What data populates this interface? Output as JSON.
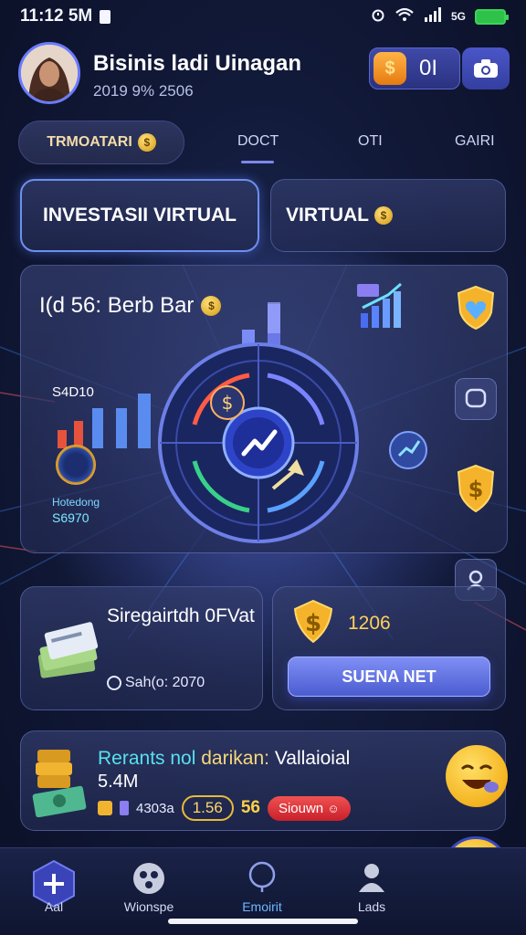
{
  "status_bar": {
    "time": "11:12 5M"
  },
  "header": {
    "user_name": "Bisinis ladi Uinagan",
    "user_sub": "2019 9% 2506",
    "coin_symbol": "$",
    "coin_value": "0I"
  },
  "tabs": {
    "active": "TRMOATARI",
    "items": [
      "DOCT",
      "OTI",
      "GAIRI"
    ]
  },
  "cards": {
    "invest_label": "INVESTASII VIRTUAL",
    "virtual_label": "VIRTUAL"
  },
  "main_panel": {
    "title": "I(d 56: Berb Bar",
    "value_label": "S4D10",
    "balance_label": "Hotedong",
    "balance_value": "S6970"
  },
  "savings": {
    "title": "Siregairtdh 0FVat",
    "subtitle": "Sah(o: 2070"
  },
  "coins": {
    "value": "1206",
    "button_label": "SUENA NET"
  },
  "rewards": {
    "title_a": "Rerants",
    "title_b": "nol",
    "title_c": "darikan:",
    "title_d": "Vallaioial",
    "amount": "5.4M",
    "stat": "4303a",
    "pill": "1.56",
    "count": "56",
    "button_label": "Siouwn"
  },
  "nav": {
    "items": [
      {
        "label": "Aal"
      },
      {
        "label": "Wionspe"
      },
      {
        "label": "Emoirit"
      },
      {
        "label": "Lads"
      }
    ]
  },
  "colors": {
    "accent": "#6d8ff0",
    "gold": "#f0b040",
    "danger": "#e03a3a",
    "cyan": "#58e0ee"
  },
  "icons": [
    "avatar",
    "coin-icon",
    "camera-icon",
    "wifi-icon",
    "signal-icon",
    "battery-icon",
    "shield-heart-icon",
    "chat-icon",
    "shield-dollar-icon",
    "profile-icon",
    "bar-chart-icon",
    "money-stack-icon",
    "gold-coin-icon",
    "emoji-icon",
    "plus-icon",
    "social-icon",
    "search-icon",
    "user-icon"
  ]
}
